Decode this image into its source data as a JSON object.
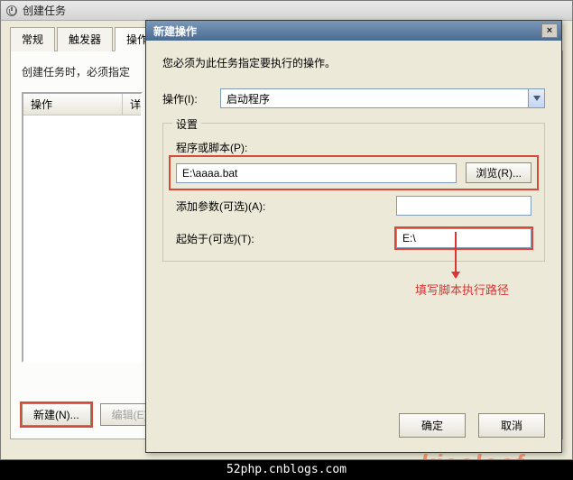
{
  "parent": {
    "title": "创建任务",
    "tabs": [
      "常规",
      "触发器",
      "操作"
    ],
    "active_tab": 2,
    "instruction": "创建任务时，必须指定",
    "list_header_action": "操作",
    "list_header_detail": "详",
    "new_btn": "新建(N)...",
    "edit_btn": "编辑(E)..."
  },
  "dialog": {
    "title": "新建操作",
    "close": "×",
    "desc": "您必须为此任务指定要执行的操作。",
    "action_label": "操作(I):",
    "action_value": "启动程序",
    "settings_legend": "设置",
    "program_label": "程序或脚本(P):",
    "program_value": "E:\\aaaa.bat",
    "browse_btn": "浏览(R)...",
    "args_label": "添加参数(可选)(A):",
    "args_value": "",
    "startin_label": "起始于(可选)(T):",
    "startin_value": "E:\\",
    "annotation": "填写脚本执行路径",
    "ok_btn": "确定",
    "cancel_btn": "取消"
  },
  "footer": {
    "text": "52php.cnblogs.com",
    "watermark": "kicoloof"
  }
}
